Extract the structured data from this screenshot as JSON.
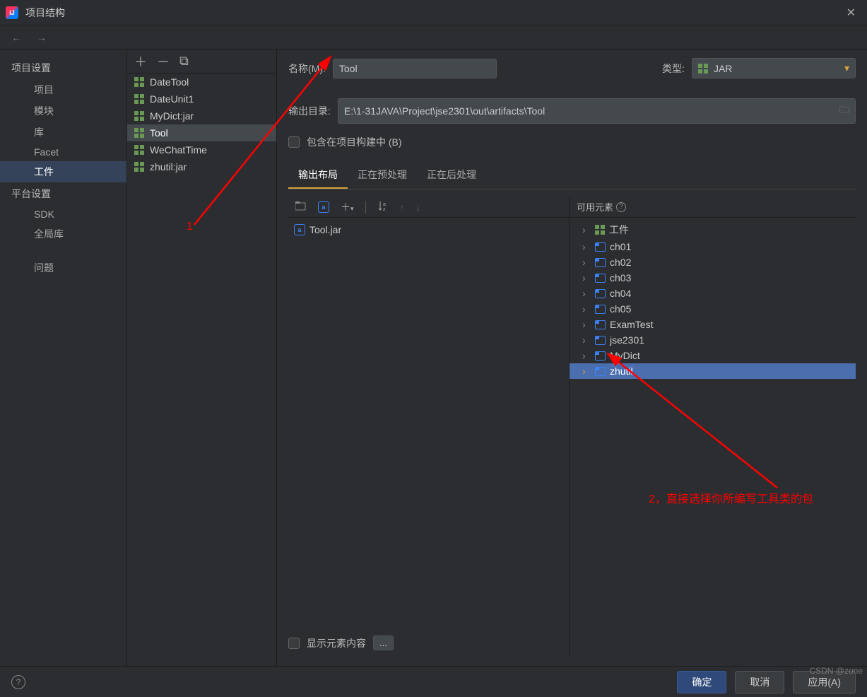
{
  "window": {
    "title": "项目结构"
  },
  "leftNav": {
    "section1": "项目设置",
    "items1": [
      "项目",
      "模块",
      "库",
      "Facet",
      "工件"
    ],
    "section2": "平台设置",
    "items2": [
      "SDK",
      "全局库"
    ],
    "problems": "问题"
  },
  "artifacts": [
    "DateTool",
    "DateUnit1",
    "MyDict:jar",
    "Tool",
    "WeChatTime",
    "zhutil:jar"
  ],
  "form": {
    "nameLabel": "名称(M):",
    "nameValue": "Tool",
    "typeLabel": "类型:",
    "typeValue": "JAR",
    "outDirLabel": "输出目录:",
    "outDirValue": "E:\\1-31JAVA\\Project\\jse2301\\out\\artifacts\\Tool",
    "includeBuild": "包含在项目构建中 (B)"
  },
  "tabs": {
    "output": "输出布局",
    "pre": "正在预处理",
    "post": "正在后处理"
  },
  "outputTree": {
    "jar": "Tool.jar"
  },
  "available": {
    "header": "可用元素",
    "items": [
      "工件",
      "ch01",
      "ch02",
      "ch03",
      "ch04",
      "ch05",
      "ExamTest",
      "jse2301",
      "MyDict",
      "zhutil"
    ]
  },
  "showElem": "显示元素内容",
  "footer": {
    "ok": "确定",
    "cancel": "取消",
    "apply": "应用(A)"
  },
  "annotations": {
    "a1": "1",
    "a2": "2，直接选择你所编写工具类的包"
  },
  "watermark": "CSDN @zone"
}
